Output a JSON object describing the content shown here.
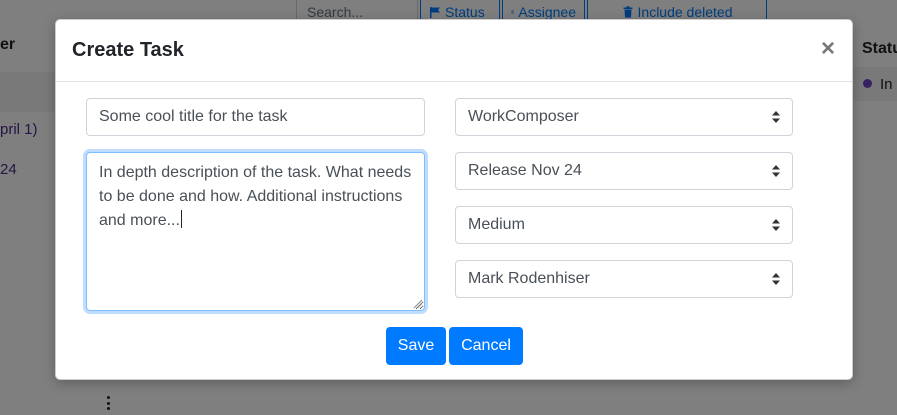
{
  "background": {
    "search_placeholder": "Search...",
    "filters": {
      "status": "Status",
      "assignee": "Assignee",
      "include_deleted": "Include deleted"
    },
    "left_header": "er",
    "left_rows": [
      "pril 1)",
      "24"
    ],
    "right_header": "Statu",
    "right_row": "In"
  },
  "modal": {
    "title": "Create Task",
    "close_glyph": "×",
    "title_input_value": "Some cool title for the task",
    "description_value": "In depth description of the task. What needs to be done and how. Additional instructions and more...",
    "selects": {
      "project": "WorkComposer",
      "release": "Release Nov 24",
      "priority": "Medium",
      "assignee": "Mark Rodenhiser"
    },
    "save_label": "Save",
    "cancel_label": "Cancel"
  },
  "colors": {
    "primary": "#007bff",
    "status_dot": "#6f42c1",
    "focus_border": "#80bdff"
  }
}
